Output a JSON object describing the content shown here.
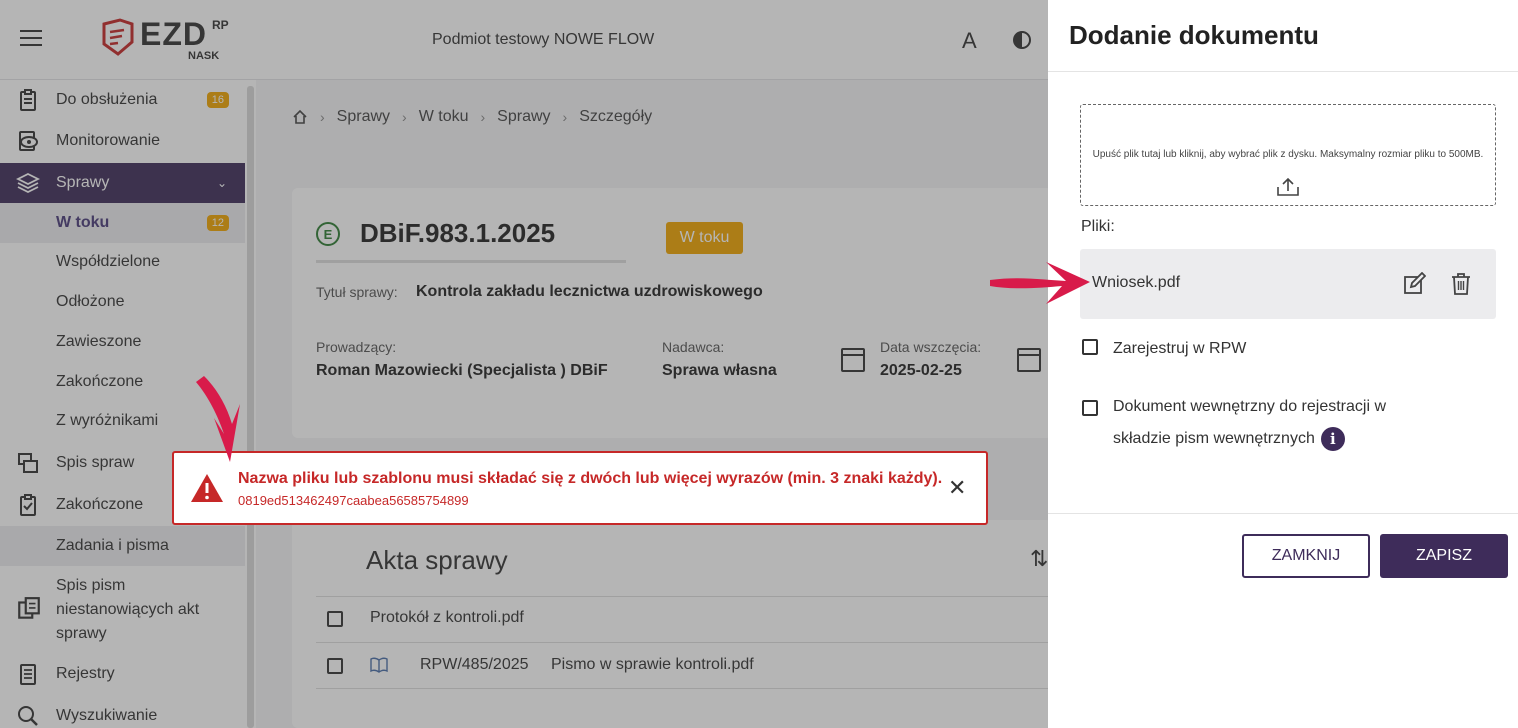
{
  "colors": {
    "brand": "#3e2c5a",
    "badge": "#f0a500",
    "error": "#c62828",
    "arrow": "#d81b4a"
  },
  "header": {
    "logo_text": "EZD",
    "logo_sup": "RP",
    "logo_sub": "NASK",
    "entity": "Podmiot testowy NOWE FLOW",
    "font_size_glyph": "A"
  },
  "sidebar": {
    "items": [
      {
        "label": "Do obsłużenia",
        "badge": "16",
        "icon": "clipboard-icon"
      },
      {
        "label": "Monitorowanie",
        "icon": "eye-icon"
      },
      {
        "label": "Sprawy",
        "icon": "layers-icon"
      },
      {
        "label": "W toku",
        "badge": "12"
      },
      {
        "label": "Współdzielone"
      },
      {
        "label": "Odłożone"
      },
      {
        "label": "Zawieszone"
      },
      {
        "label": "Zakończone"
      },
      {
        "label": "Z wyróżnikami"
      },
      {
        "label": "Spis spraw",
        "icon": "stack-icon"
      },
      {
        "label": "Zakończone",
        "icon": "clipboard-check-icon"
      },
      {
        "label": "Zadania i pisma"
      },
      {
        "label": "Spis pism niestanowiących akt sprawy",
        "line1": "Spis pism",
        "line2": "niestanowiących akt",
        "line3": "sprawy",
        "icon": "documents-icon"
      },
      {
        "label": "Rejestry",
        "icon": "register-icon"
      },
      {
        "label": "Wyszukiwanie",
        "icon": "search-icon"
      }
    ]
  },
  "breadcrumb": [
    "Sprawy",
    "W toku",
    "Sprawy",
    "Szczegóły"
  ],
  "case": {
    "e_badge": "E",
    "number": "DBiF.983.1.2025",
    "status": "W toku",
    "title_label": "Tytuł sprawy:",
    "title_value": "Kontrola zakładu lecznictwa uzdrowiskowego",
    "owner_label": "Prowadzący:",
    "owner_value": "Roman Mazowiecki (Specjalista ) DBiF",
    "sender_label": "Nadawca:",
    "sender_value": "Sprawa własna",
    "start_label": "Data wszczęcia:",
    "start_value": "2025-02-25"
  },
  "akta": {
    "title": "Akta sprawy",
    "rows": [
      {
        "name": "Protokół z kontroli.pdf"
      },
      {
        "rpw": "RPW/485/2025",
        "name": "Pismo w sprawie kontroli.pdf"
      }
    ]
  },
  "toast": {
    "message": "Nazwa pliku lub szablonu musi składać się z dwóch lub więcej wyrazów (min. 3 znaki każdy).",
    "code": "0819ed513462497caabea56585754899",
    "close": "✕"
  },
  "drawer": {
    "title": "Dodanie dokumentu",
    "dropzone_text": "Upuść plik tutaj lub kliknij, aby wybrać plik z dysku. Maksymalny rozmiar pliku to 500MB.",
    "files_label": "Pliki:",
    "file_name": "Wniosek.pdf",
    "register_rpw": "Zarejestruj w RPW",
    "internal_doc_line1": "Dokument wewnętrzny do rejestracji w",
    "internal_doc_line2": "składzie pism wewnętrznych",
    "info_glyph": "i",
    "close_button": "ZAMKNIJ",
    "save_button": "ZAPISZ"
  }
}
